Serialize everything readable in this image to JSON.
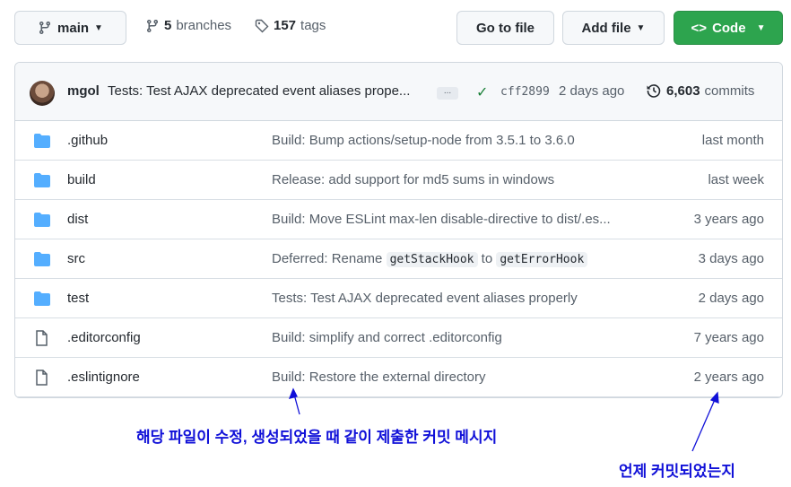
{
  "header": {
    "branch": "main",
    "branches_count": "5",
    "branches_label": "branches",
    "tags_count": "157",
    "tags_label": "tags",
    "goto_file": "Go to file",
    "add_file": "Add file",
    "code": "Code"
  },
  "latest_commit": {
    "author": "mgol",
    "message": "Tests: Test AJAX deprecated event aliases prope...",
    "ellipsis": "...",
    "sha": "cff2899",
    "ago": "2 days ago",
    "commits_count": "6,603",
    "commits_label": "commits"
  },
  "files": [
    {
      "type": "folder",
      "name": ".github",
      "message": "Build: Bump actions/setup-node from 3.5.1 to 3.6.0",
      "ago": "last month"
    },
    {
      "type": "folder",
      "name": "build",
      "message": "Release: add support for md5 sums in windows",
      "ago": "last week"
    },
    {
      "type": "folder",
      "name": "dist",
      "message": "Build: Move ESLint max-len disable-directive to dist/.es...",
      "ago": "3 years ago"
    },
    {
      "type": "folder",
      "name": "src",
      "message_parts": [
        "Deferred: Rename",
        "getStackHook",
        "to",
        "getErrorHook"
      ],
      "ago": "3 days ago"
    },
    {
      "type": "folder",
      "name": "test",
      "message": "Tests: Test AJAX deprecated event aliases properly",
      "ago": "2 days ago"
    },
    {
      "type": "file",
      "name": ".editorconfig",
      "message": "Build: simplify and correct .editorconfig",
      "ago": "7 years ago"
    },
    {
      "type": "file",
      "name": ".eslintignore",
      "message": "Build: Restore the external directory",
      "ago": "2 years ago"
    }
  ],
  "annotations": {
    "commit_message_note": "해당 파일이 수정, 생성되었을 때 같이 제출한 커밋 메시지",
    "commit_time_note": "언제 커밋되었는지",
    "color": "#1010d8"
  },
  "colors": {
    "code_button": "#2da44e",
    "folder_icon": "#54aeff",
    "check": "#1a7f37"
  }
}
